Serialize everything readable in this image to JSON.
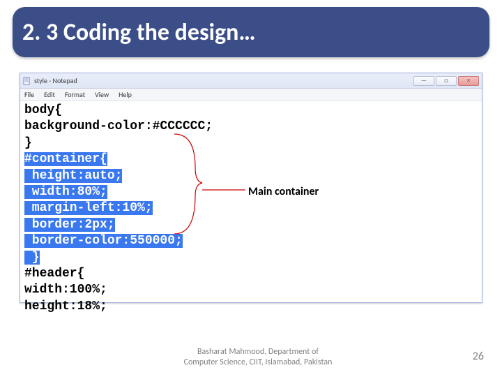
{
  "title": "2. 3 Coding the design…",
  "notepad": {
    "window_title": "style - Notepad",
    "menu": [
      "File",
      "Edit",
      "Format",
      "View",
      "Help"
    ],
    "window_controls": {
      "min": "—",
      "max": "□",
      "close": "×"
    },
    "code_lines": [
      {
        "text": "body{",
        "selected": false
      },
      {
        "text": "background-color:#CCCCCC;",
        "selected": false
      },
      {
        "text": "}",
        "selected": false
      },
      {
        "text": "#container{",
        "selected": true
      },
      {
        "text": " height:auto;",
        "selected": true
      },
      {
        "text": " width:80%;",
        "selected": true
      },
      {
        "text": " margin-left:10%;",
        "selected": true
      },
      {
        "text": " border:2px;",
        "selected": true
      },
      {
        "text": " border-color:550000;",
        "selected": true
      },
      {
        "text": " }",
        "selected": true
      },
      {
        "text": "#header{",
        "selected": false
      },
      {
        "text": "width:100%;",
        "selected": false
      },
      {
        "text": "height:18%;",
        "selected": false
      }
    ]
  },
  "annotation": {
    "label": "Main container"
  },
  "footer": {
    "line1": "Basharat Mahmood, Department of",
    "line2": "Computer Science, CIIT, Islamabad, Pakistan"
  },
  "page_number": "26"
}
